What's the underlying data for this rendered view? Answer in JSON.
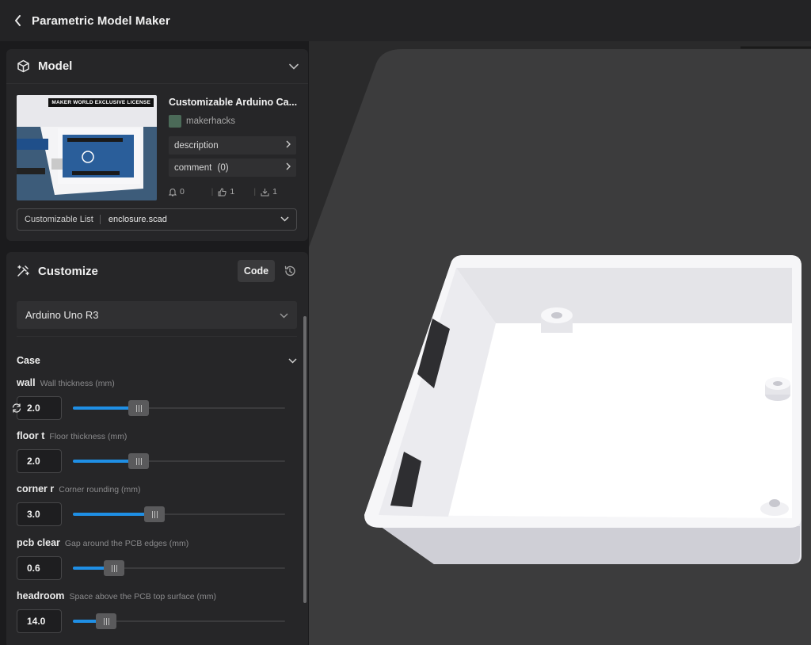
{
  "app": {
    "title": "Parametric Model Maker"
  },
  "model_panel": {
    "title": "Model",
    "badge": "MAKER WORLD EXCLUSIVE LICENSE",
    "name": "Customizable Arduino Ca...",
    "author": "makerhacks",
    "description_label": "description",
    "comment_label": "comment",
    "comment_count": "(0)",
    "stats": {
      "boosts": "0",
      "likes": "1",
      "downloads": "1"
    },
    "customizable_list_label": "Customizable List",
    "customizable_list_value": "enclosure.scad"
  },
  "customize_panel": {
    "title": "Customize",
    "code_label": "Code",
    "preset": "Arduino Uno R3",
    "section_title": "Case",
    "params": [
      {
        "name": "wall",
        "desc": "Wall thickness (mm)",
        "value": "2.0",
        "level": 0.29
      },
      {
        "name": "floor t",
        "desc": "Floor thickness (mm)",
        "value": "2.0",
        "level": 0.29
      },
      {
        "name": "corner r",
        "desc": "Corner rounding (mm)",
        "value": "3.0",
        "level": 0.37
      },
      {
        "name": "pcb clear",
        "desc": "Gap around the PCB edges (mm)",
        "value": "0.6",
        "level": 0.16
      },
      {
        "name": "headroom",
        "desc": "Space above the PCB top surface (mm)",
        "value": "14.0",
        "level": 0.12
      }
    ]
  },
  "colors": {
    "accent": "#1f8fe5",
    "panel": "#262628",
    "background": "#1b1b1d"
  }
}
